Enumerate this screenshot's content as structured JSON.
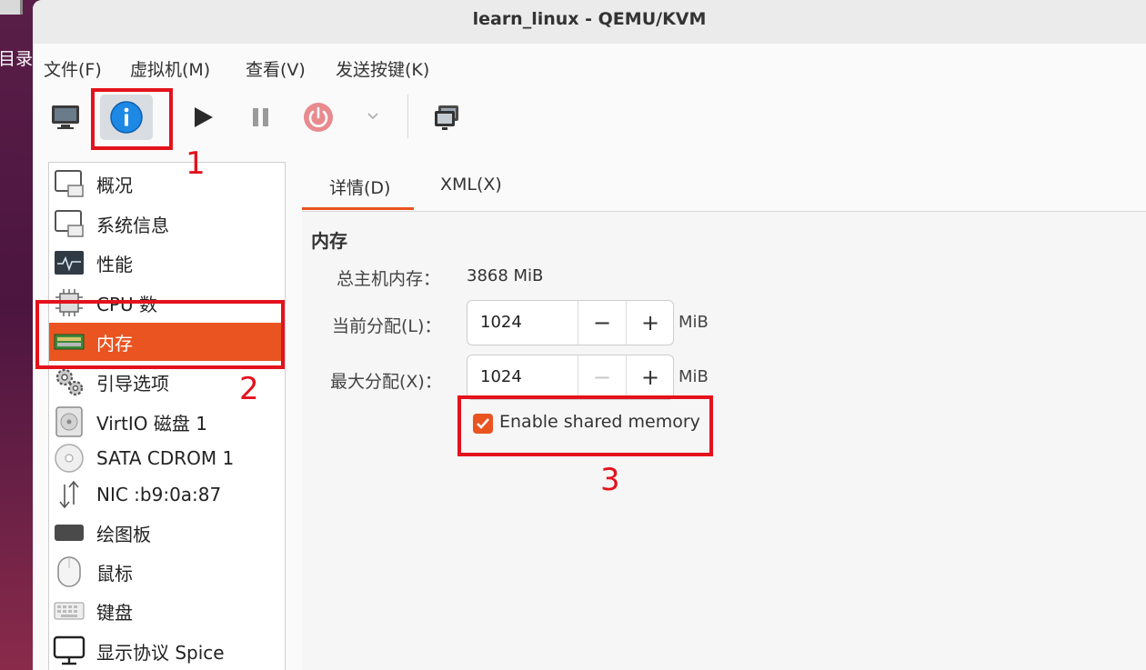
{
  "desktop": {
    "side_label": "目录"
  },
  "window": {
    "title": "learn_linux - QEMU/KVM"
  },
  "menubar": [
    "文件(F)",
    "虚拟机(M)",
    "查看(V)",
    "发送按键(K)"
  ],
  "toolbar": {
    "buttons": [
      "console-view",
      "details-view",
      "run",
      "pause",
      "shutdown",
      "shutdown-menu",
      "fullscreen"
    ],
    "accent": "#1e88e5"
  },
  "sidebar": {
    "items": [
      {
        "label": "概况",
        "icon": "monitor-icon"
      },
      {
        "label": "系统信息",
        "icon": "monitor-icon"
      },
      {
        "label": "性能",
        "icon": "performance-icon"
      },
      {
        "label": "CPU 数",
        "icon": "cpu-icon"
      },
      {
        "label": "内存",
        "icon": "memory-icon",
        "selected": true
      },
      {
        "label": "引导选项",
        "icon": "gears-icon"
      },
      {
        "label": "VirtIO 磁盘 1",
        "icon": "disk-icon"
      },
      {
        "label": "SATA CDROM 1",
        "icon": "cdrom-icon"
      },
      {
        "label": "NIC :b9:0a:87",
        "icon": "network-icon"
      },
      {
        "label": "绘图板",
        "icon": "tablet-icon"
      },
      {
        "label": "鼠标",
        "icon": "mouse-icon"
      },
      {
        "label": "键盘",
        "icon": "keyboard-icon"
      },
      {
        "label": "显示协议 Spice",
        "icon": "display-icon"
      }
    ]
  },
  "tabs": [
    {
      "label": "详情(D)",
      "active": true
    },
    {
      "label": "XML(X)",
      "active": false
    }
  ],
  "memory": {
    "section_title": "内存",
    "total_label": "总主机内存：",
    "total_value": "3868 MiB",
    "current_label": "当前分配(L)：",
    "current_value": "1024",
    "max_label": "最大分配(X)：",
    "max_value": "1024",
    "unit": "MiB",
    "minus": "−",
    "plus": "+",
    "shared_memory_label": "Enable shared memory",
    "shared_memory_checked": true
  },
  "annotations": [
    "1",
    "2",
    "3"
  ],
  "colors": {
    "accent": "#e95420",
    "annotation": "#e3121c"
  }
}
